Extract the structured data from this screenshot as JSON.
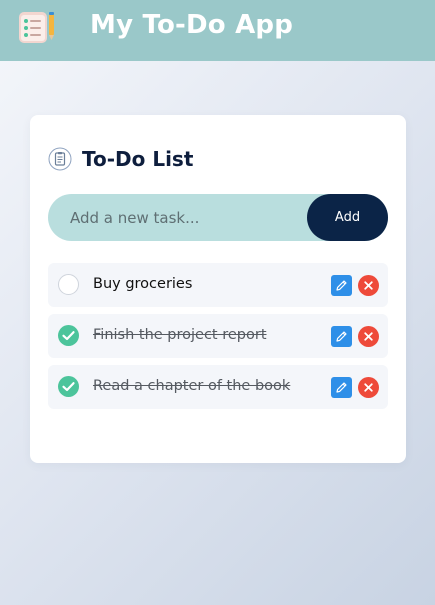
{
  "header": {
    "title": "My To-Do App",
    "logo_icon": "notepad-pencil-icon",
    "background_color": "#9ac8c9"
  },
  "card": {
    "title": "To-Do List",
    "title_icon": "clipboard-icon"
  },
  "input": {
    "placeholder": "Add a new task...",
    "value": "",
    "add_label": "Add"
  },
  "tasks": [
    {
      "text": "Buy groceries",
      "completed": false
    },
    {
      "text": "Finish the project report",
      "completed": true
    },
    {
      "text": "Read a chapter of the book",
      "completed": true
    }
  ],
  "colors": {
    "accent_dark": "#0b2447",
    "input_bg": "#b9dede",
    "check_green": "#4cc49b",
    "edit_blue": "#2e8fe8",
    "delete_red": "#ee4a3a"
  },
  "icons": {
    "edit": "pencil-icon",
    "delete": "close-icon",
    "complete": "checkmark-icon"
  }
}
